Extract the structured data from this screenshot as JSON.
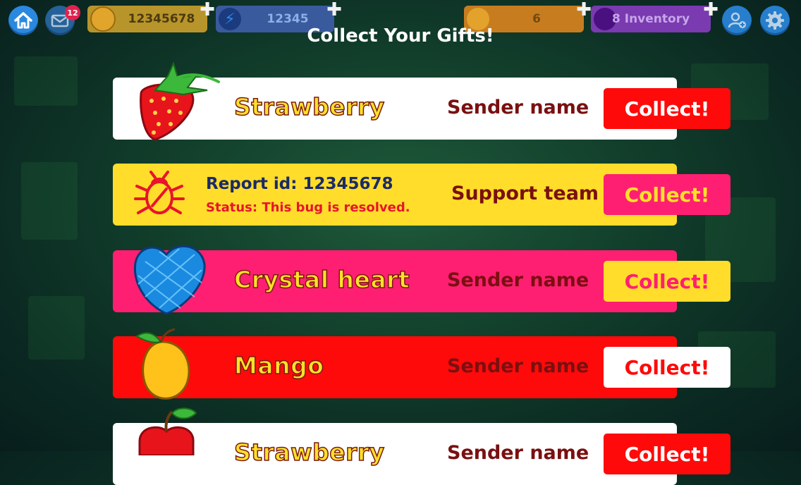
{
  "topbar": {
    "mail_badge": "12",
    "coins": "12345678",
    "energy": "12345",
    "lives": "6",
    "inventory": "8 Inventory"
  },
  "title": "Collect Your Gifts!",
  "gifts": [
    {
      "name": "Strawberry",
      "sender": "Sender name",
      "button": "Collect!",
      "icon": "strawberry-icon"
    },
    {
      "report_id": "Report id: 12345678",
      "status": "Status: This bug is resolved.",
      "sender": "Support team",
      "button": "Collect!",
      "icon": "bug-icon"
    },
    {
      "name": "Crystal heart",
      "sender": "Sender name",
      "button": "Collect!",
      "icon": "crystal-heart-icon"
    },
    {
      "name": "Mango",
      "sender": "Sender name",
      "button": "Collect!",
      "icon": "mango-icon"
    },
    {
      "name": "Strawberry",
      "sender": "Sender name",
      "button": "Collect!",
      "icon": "apple-icon"
    }
  ],
  "colors": {
    "white_row": "#ffffff",
    "yellow_row": "#ffdd2a",
    "pink_row": "#ff1f72",
    "red_row": "#ff0a0a",
    "sender_text": "#7a1010"
  }
}
